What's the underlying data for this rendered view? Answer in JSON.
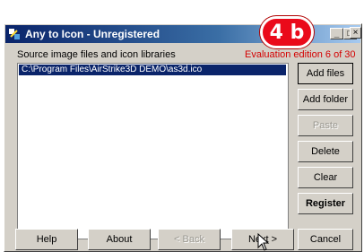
{
  "window": {
    "title": "Any to Icon - Unregistered",
    "controls": [
      "minimize",
      "maximize",
      "close"
    ]
  },
  "labels": {
    "source": "Source image files and icon libraries",
    "evaluation": "Evaluation edition 6 of 30"
  },
  "list": {
    "items": [
      "C:\\Program Files\\AirStrike3D DEMO\\as3d.ico"
    ]
  },
  "buttons": {
    "add_files": "Add files",
    "add_folder": "Add folder",
    "paste": "Paste",
    "delete": "Delete",
    "clear": "Clear",
    "register": "Register",
    "help": "Help",
    "about": "About",
    "back": "< Back",
    "next": "Next >",
    "cancel": "Cancel"
  },
  "callout": {
    "text": "4 b"
  },
  "icons": {
    "app": "app-icon",
    "minimize": "minimize-icon",
    "maximize": "maximize-icon",
    "close": "close-icon",
    "cursor": "mouse-cursor-icon"
  },
  "colors": {
    "titlebar": "#0a246a",
    "selection": "#0a246a",
    "evaluation_text": "#d40000",
    "badge": "#ea0a1a"
  }
}
